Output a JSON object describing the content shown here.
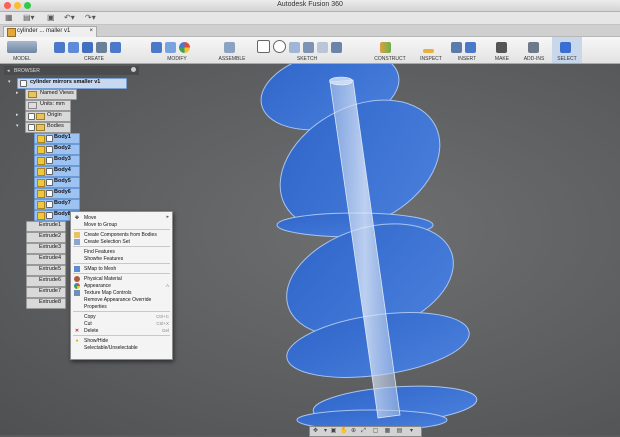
{
  "window": {
    "title": "Autodesk Fusion 360"
  },
  "tab": {
    "title": "cylinder ... maller v1",
    "close": "×"
  },
  "toolbar": {
    "workspace": "MODEL",
    "sections": [
      "CREATE",
      "MODIFY",
      "ASSEMBLE",
      "SKETCH",
      "CONSTRUCT",
      "INSPECT",
      "INSERT",
      "MAKE",
      "ADD-INS",
      "SELECT"
    ]
  },
  "browser": {
    "header": "BROWSER",
    "root": "cylinder mirrors smaller v1",
    "items": [
      {
        "label": "Named Views",
        "kind": "folder"
      },
      {
        "label": "Units: mm",
        "kind": "unit"
      },
      {
        "label": "Origin",
        "kind": "folder"
      },
      {
        "label": "Bodies",
        "kind": "folder"
      }
    ],
    "bodies": [
      "Body1",
      "Body2",
      "Body3",
      "Body4",
      "Body5",
      "Body6",
      "Body7",
      "Body8"
    ],
    "features": [
      "Extrude1",
      "Extrude2",
      "Extrude3",
      "Extrude4",
      "Extrude5",
      "Extrude6",
      "Extrude7",
      "Extrude8"
    ]
  },
  "context_menu": {
    "items": [
      {
        "label": "Move",
        "icon": "move-icon",
        "sep_after": false
      },
      {
        "label": "Move to Group",
        "icon": "",
        "sep_after": true
      },
      {
        "label": "Create Components from Bodies",
        "icon": "component-icon",
        "sep_after": false
      },
      {
        "label": "Create Selection Set",
        "icon": "selection-set-icon",
        "sep_after": true
      },
      {
        "label": "Find Features",
        "icon": "",
        "sep_after": false
      },
      {
        "label": "Showhe Features",
        "icon": "",
        "sep_after": true
      },
      {
        "label": "SMap to Mesh",
        "icon": "mesh-icon",
        "sep_after": true
      },
      {
        "label": "Physical Material",
        "icon": "material-icon",
        "sep_after": false
      },
      {
        "label": "Appearance",
        "icon": "appearance-icon",
        "sep_after": false,
        "shortcut": "A"
      },
      {
        "label": "Texture Map Controls",
        "icon": "texture-icon",
        "sep_after": false
      },
      {
        "label": "Remove Appearance Override",
        "icon": "",
        "sep_after": false
      },
      {
        "label": "Properties",
        "icon": "",
        "sep_after": true
      },
      {
        "label": "Copy",
        "icon": "",
        "sep_after": false,
        "shortcut": "Ctrl+C"
      },
      {
        "label": "Cut",
        "icon": "",
        "sep_after": false,
        "shortcut": "Ctrl+X"
      },
      {
        "label": "Delete",
        "icon": "delete-icon",
        "sep_after": true,
        "shortcut": "Del"
      },
      {
        "label": "Show/Hide",
        "icon": "bulb-icon",
        "sep_after": false
      },
      {
        "label": "Selectable/Unselectable",
        "icon": "",
        "sep_after": false
      }
    ]
  },
  "colors": {
    "body_blue": "#3a6fd0",
    "selection_blue": "#9cc3f2",
    "viewport_gray": "#5f6062"
  }
}
